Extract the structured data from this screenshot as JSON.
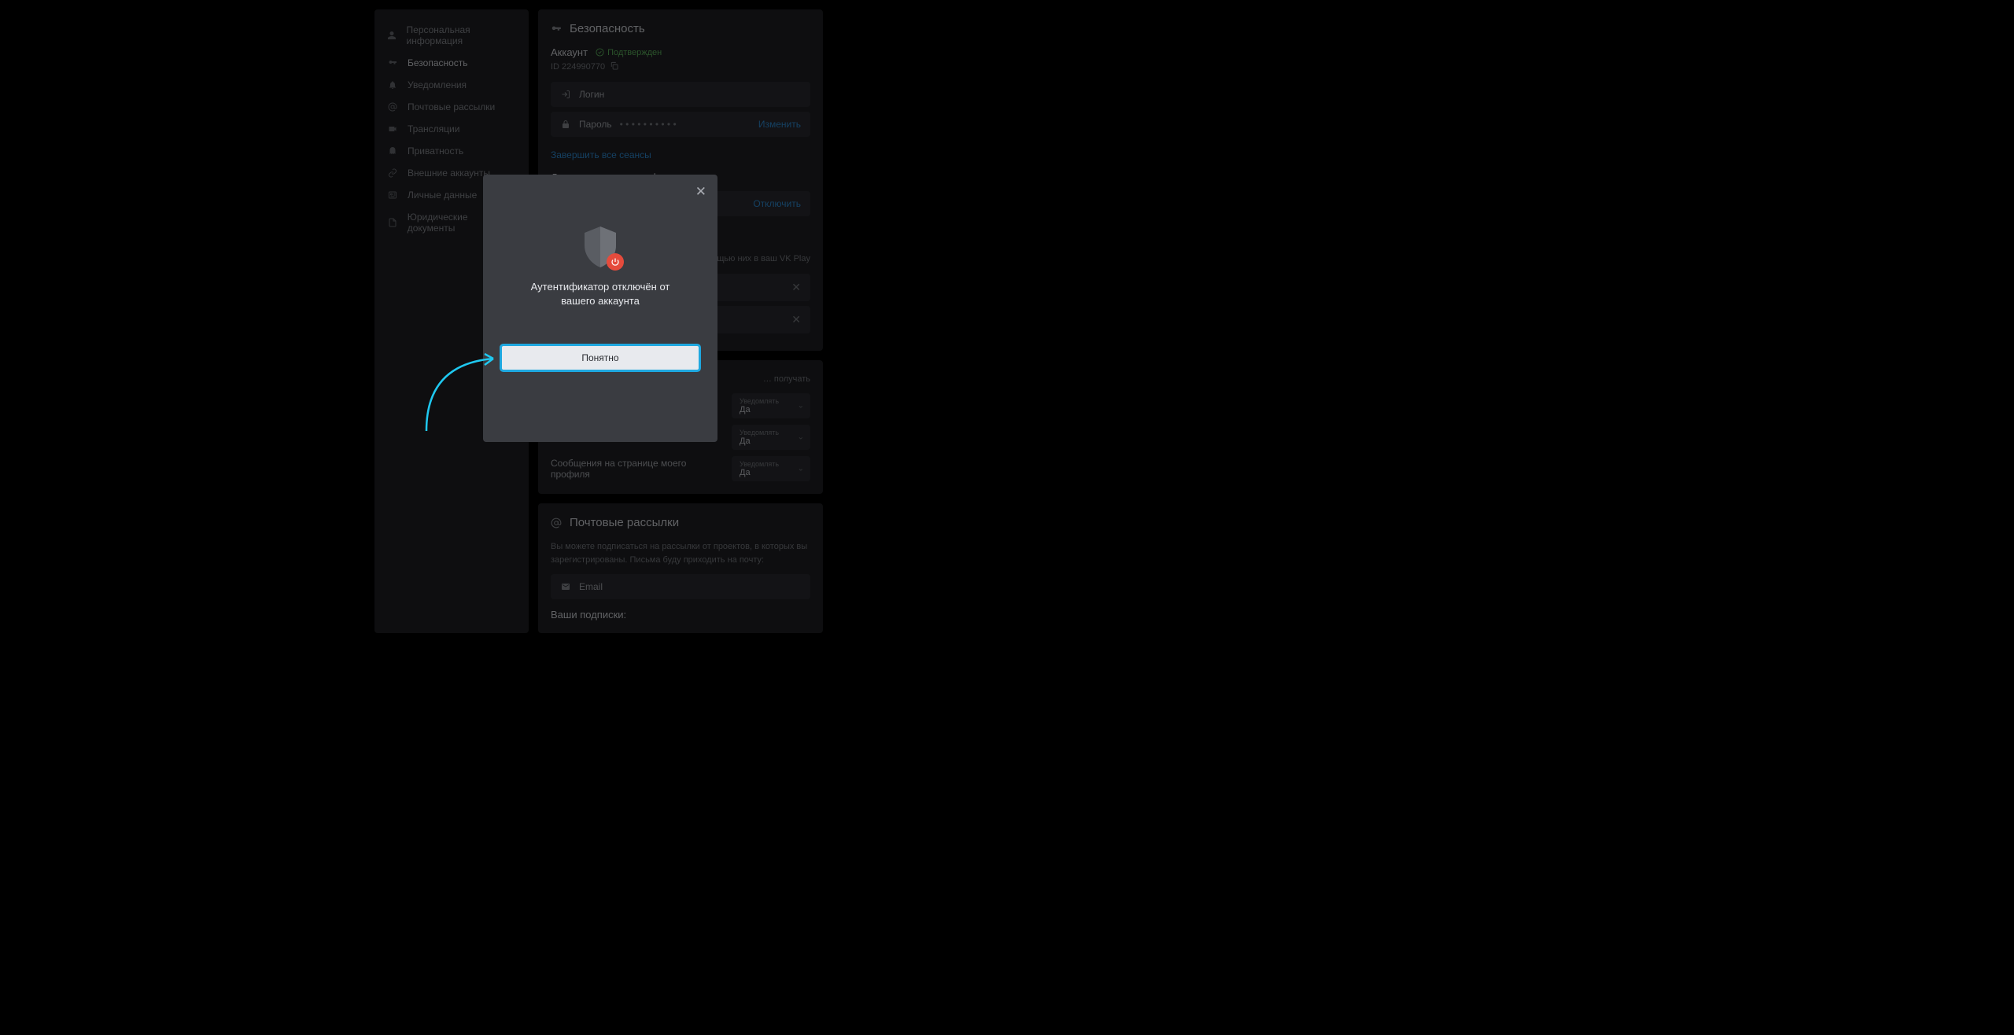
{
  "sidebar": {
    "items": [
      {
        "label": "Персональная информация"
      },
      {
        "label": "Безопасность"
      },
      {
        "label": "Уведомления"
      },
      {
        "label": "Почтовые рассылки"
      },
      {
        "label": "Трансляции"
      },
      {
        "label": "Приватность"
      },
      {
        "label": "Внешние аккаунты"
      },
      {
        "label": "Личные данные"
      },
      {
        "label": "Юридические документы"
      }
    ]
  },
  "security": {
    "title": "Безопасность",
    "account_label": "Аккаунт",
    "verified": "Подтвержден",
    "id_label": "ID 224990770",
    "login_label": "Логин",
    "login_value": "",
    "password_label": "Пароль",
    "password_value": "• • • • • • • • • •",
    "change": "Изменить",
    "end_sessions": "Завершить все сеансы",
    "tfa_title": "Двухэтапная аутентификация",
    "tfa_disable": "Отключить",
    "linked_helper": "… ощью них в ваш VK Play",
    "notif_title": "",
    "notif_helper": "… получать",
    "notify_caption": "Уведомлять",
    "notify_value": "Да",
    "notif3_label": "Сообщения на странице моего профиля"
  },
  "mail": {
    "title": "Почтовые рассылки",
    "helper": "Вы можете подписаться на рассылки от проектов, в которых вы зарегистрированы. Письма буду приходить на почту:",
    "email_label": "Email",
    "subs_title": "Ваши подписки:"
  },
  "modal": {
    "title": "Аутентификатор отключён от вашего аккаунта",
    "button": "Понятно"
  }
}
